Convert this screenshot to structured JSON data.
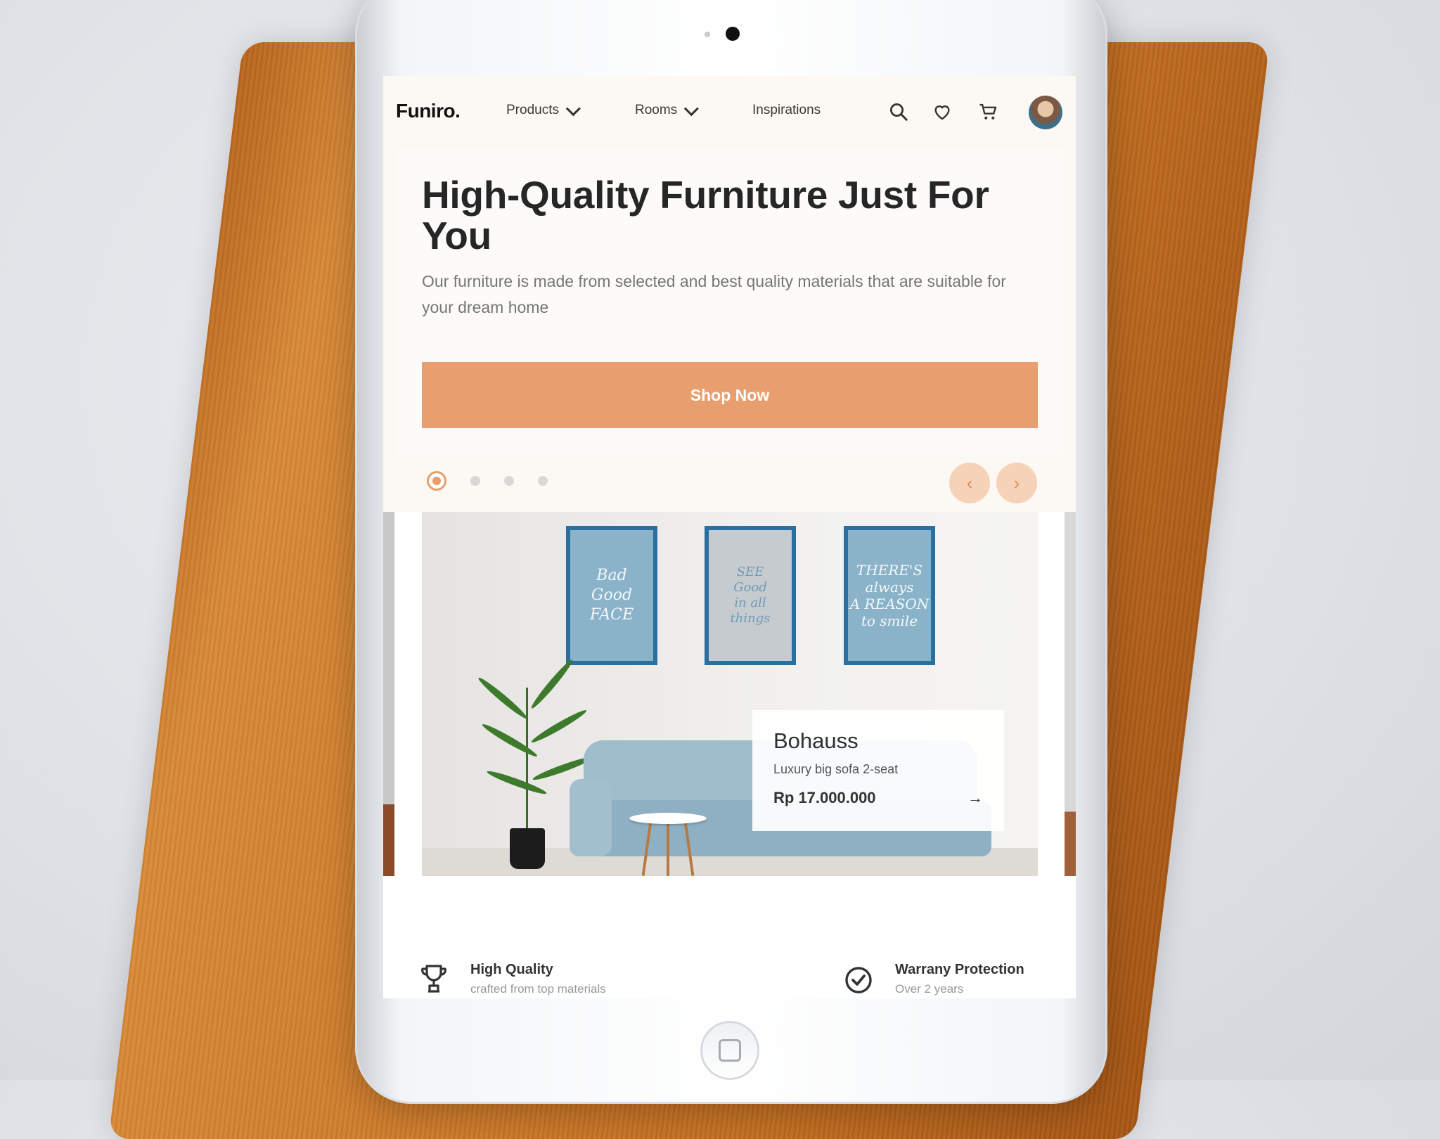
{
  "brand": {
    "logo": "Funiro."
  },
  "nav": {
    "items": [
      {
        "label": "Products"
      },
      {
        "label": "Rooms"
      },
      {
        "label": "Inspirations"
      }
    ],
    "icons": [
      "search-icon",
      "heart-icon",
      "cart-icon",
      "avatar"
    ]
  },
  "hero": {
    "title": "High-Quality Furniture Just For You",
    "subtitle": "Our furniture is made from selected and best quality materials that are suitable for your dream home",
    "cta": "Shop Now"
  },
  "carousel": {
    "dots": 4,
    "active_index": 0,
    "prev_label": "‹",
    "next_label": "›"
  },
  "artwork": {
    "frame1": "Bad\nGood\nFACE",
    "frame2": "SEE\nGood\nin all\nthings",
    "frame3": "THERE'S\nalways\nA REASON\nto smile"
  },
  "product": {
    "name": "Bohauss",
    "description": "Luxury big sofa 2-seat",
    "price": "Rp 17.000.000",
    "arrow": "→"
  },
  "features": [
    {
      "title": "High Quality",
      "subtitle": "crafted from top materials"
    },
    {
      "title": "Warrany Protection",
      "subtitle": "Over 2 years"
    }
  ],
  "colors": {
    "accent": "#E89E6F",
    "background": "#FCF8F3",
    "text_dark": "#262626"
  }
}
